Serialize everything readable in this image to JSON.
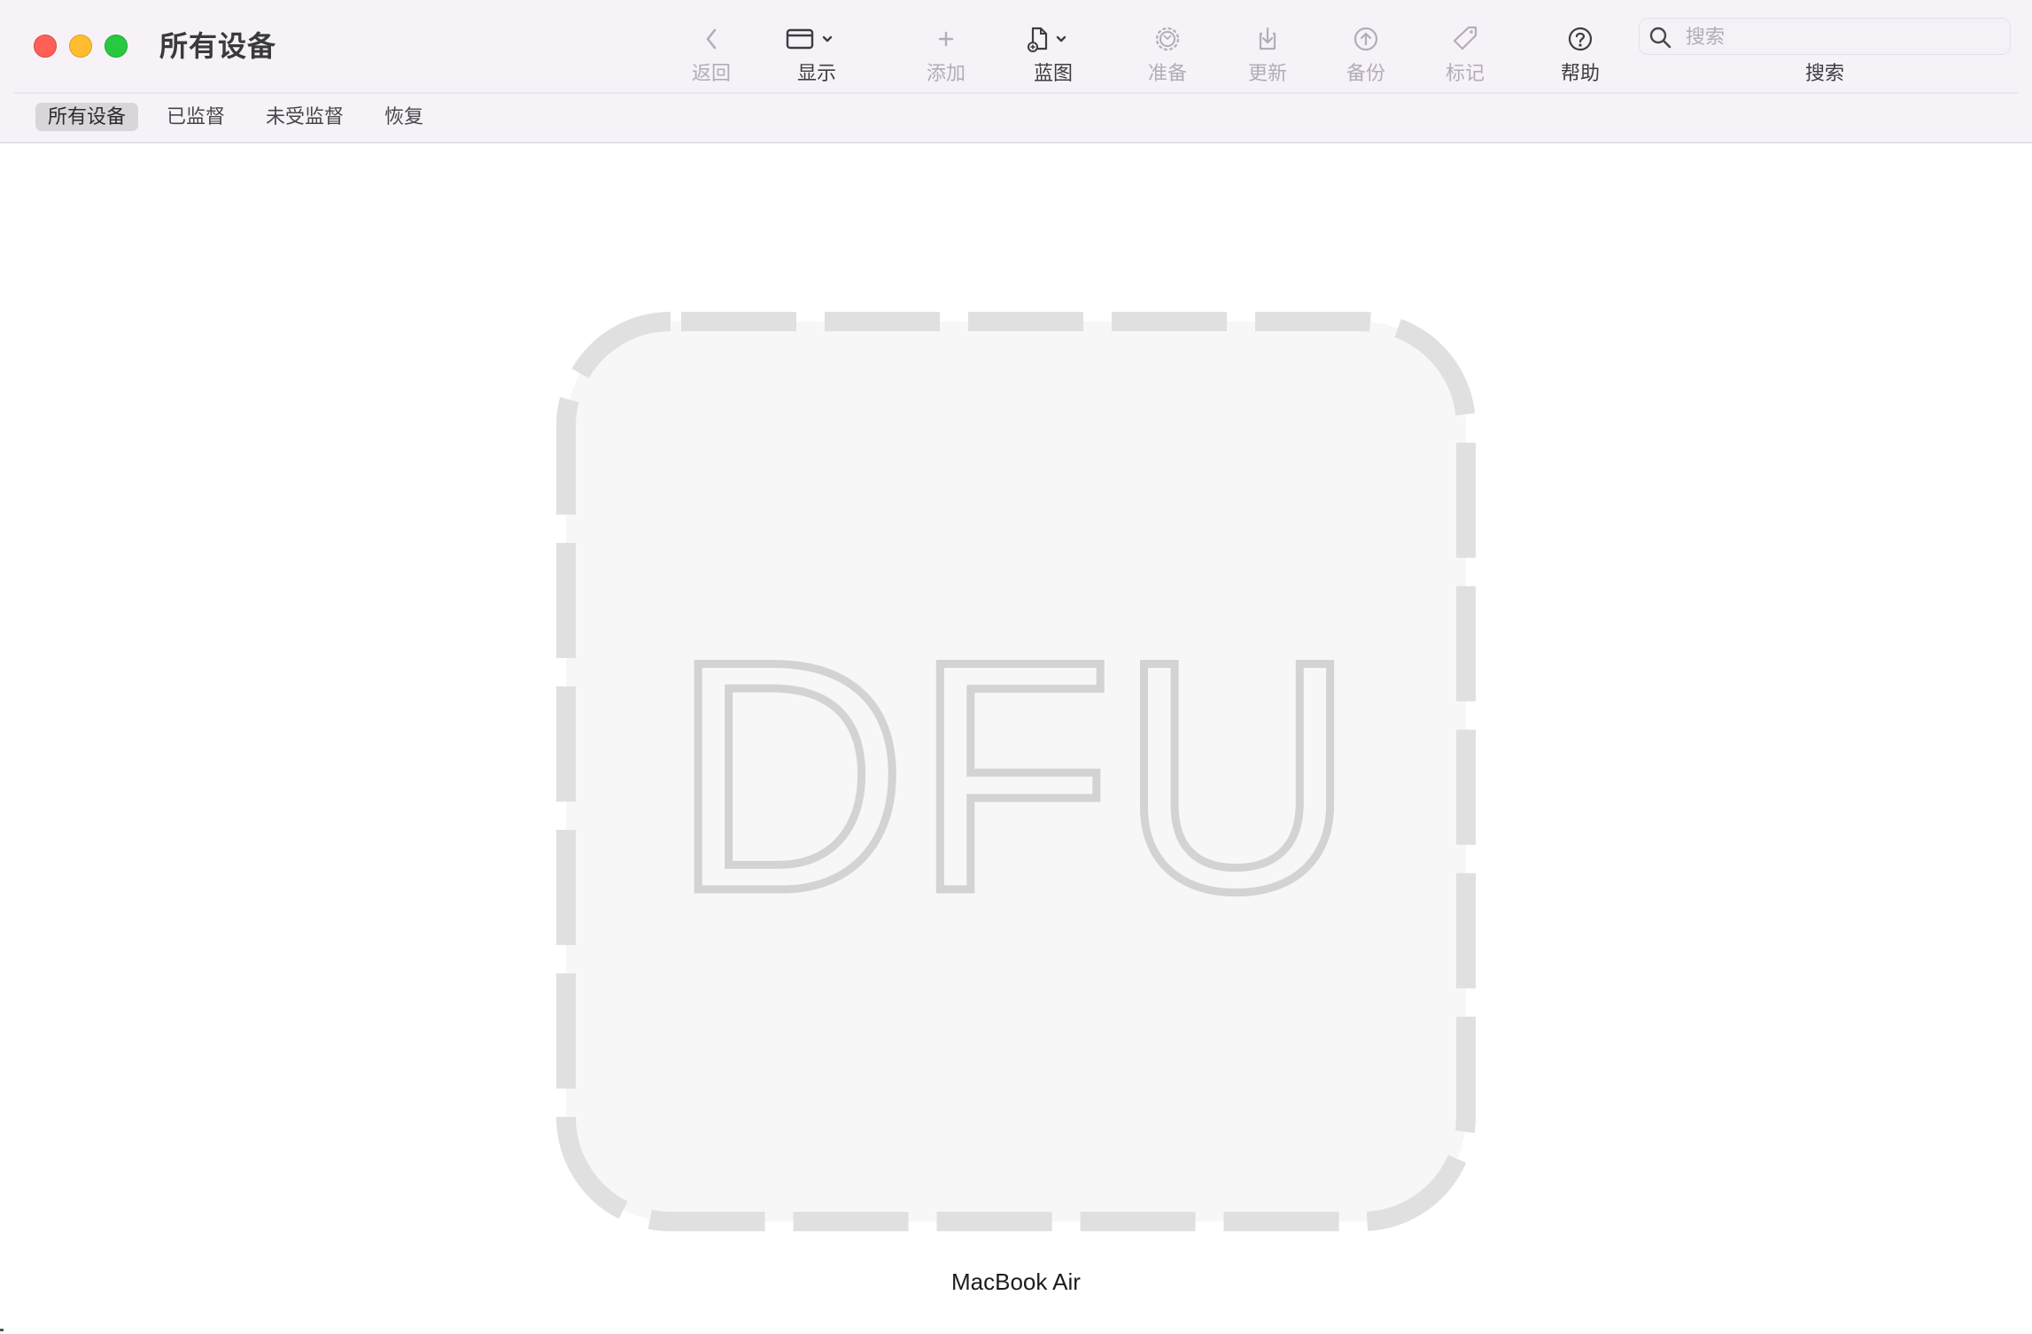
{
  "window": {
    "title": "所有设备",
    "controls": [
      "close",
      "minimize",
      "zoom"
    ]
  },
  "toolbar": {
    "items": [
      {
        "label": "返回",
        "icon": "chevron-left-icon",
        "enabled": false
      },
      {
        "label": "显示",
        "icon": "window-view-icon",
        "enabled": true,
        "has_menu": true
      },
      {
        "label": "添加",
        "icon": "plus-icon",
        "enabled": false
      },
      {
        "label": "蓝图",
        "icon": "blueprint-document-icon",
        "enabled": true,
        "has_menu": true
      },
      {
        "label": "准备",
        "icon": "gear-icon",
        "enabled": false
      },
      {
        "label": "更新",
        "icon": "download-tray-icon",
        "enabled": false
      },
      {
        "label": "备份",
        "icon": "upload-circle-icon",
        "enabled": false
      },
      {
        "label": "标记",
        "icon": "tag-icon",
        "enabled": false
      },
      {
        "label": "帮助",
        "icon": "question-circle-icon",
        "enabled": true
      }
    ]
  },
  "search": {
    "placeholder": "搜索",
    "value": "",
    "label": "搜索"
  },
  "tabs": [
    {
      "label": "所有设备",
      "active": true
    },
    {
      "label": "已监督",
      "active": false
    },
    {
      "label": "未受监督",
      "active": false
    },
    {
      "label": "恢复",
      "active": false
    }
  ],
  "device": {
    "mode_text": "DFU",
    "name": "MacBook Air"
  },
  "colors": {
    "titlebar_bg": "#f7f2f8",
    "tile_fill": "#f7f7f7",
    "tile_dash": "#e0e0e0",
    "dfu_text": "#d4d4d4",
    "active_tab_bg": "#d9d5db",
    "disabled_text": "#b3adb5",
    "enabled_text": "#3f3b41"
  }
}
